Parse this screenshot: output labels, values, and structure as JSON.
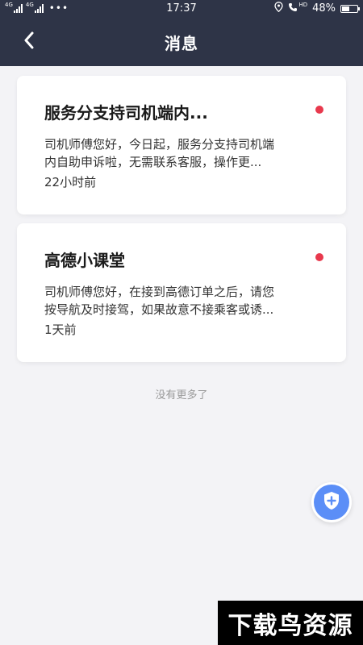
{
  "status_bar": {
    "network_1": "4G",
    "network_2": "4G",
    "dots": "•••",
    "time": "17:37",
    "hd": "HD",
    "battery": "48%",
    "battery_level": 0.48
  },
  "header": {
    "title": "消息"
  },
  "messages": [
    {
      "title": "服务分支持司机端内...",
      "body_line1": "司机师傅您好，今日起，服务分支持司机端",
      "body_line2": "内自助申诉啦，无需联系客服，操作更...",
      "time": "22小时前",
      "unread": true
    },
    {
      "title": "高德小课堂",
      "body_line1": "司机师傅您好，在接到高德订单之后，请您",
      "body_line2": "按导航及时接驾，如果故意不接乘客或诱...",
      "time": "1天前",
      "unread": true
    }
  ],
  "footer": {
    "no_more": "没有更多了"
  },
  "watermark": "下载鸟资源",
  "colors": {
    "header_bg": "#2e3447",
    "page_bg": "#f3f3f6",
    "unread_dot": "#e8394d",
    "fab_blue": "#5b8ef7"
  },
  "icons": {
    "back": "chevron-left-icon",
    "fab": "shield-plus-icon",
    "location": "location-pin-icon",
    "call": "phone-call-icon"
  }
}
